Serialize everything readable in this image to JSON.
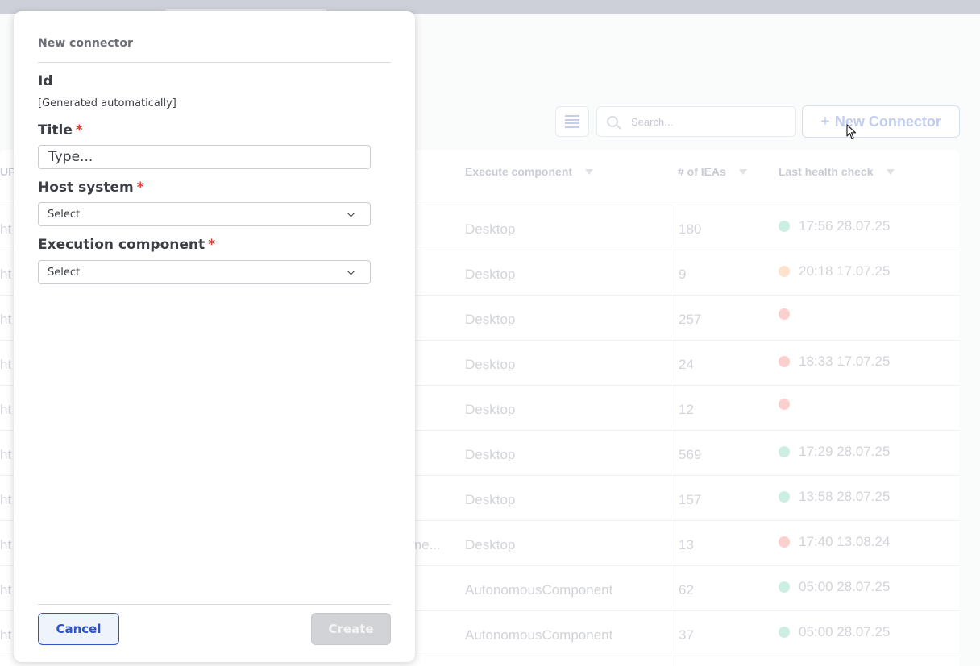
{
  "background": {
    "search_placeholder": "Search...",
    "new_connector_button": "+ New Connector",
    "plus": "+",
    "new_connector_label": "New Connector",
    "columns": {
      "ur_partial": "UF",
      "execute_component": "Execute component",
      "num_ieas": "# of IEAs",
      "last_health_check": "Last health check"
    },
    "rows": [
      {
        "c0": "ht",
        "mid": "",
        "component": "Desktop",
        "ieas": "180",
        "status": "green",
        "time": "17:56 28.07.25"
      },
      {
        "c0": "ht",
        "mid": "",
        "component": "Desktop",
        "ieas": "9",
        "status": "orange",
        "time": "20:18 17.07.25"
      },
      {
        "c0": "ht",
        "mid": "",
        "component": "Desktop",
        "ieas": "257",
        "status": "red",
        "time": ""
      },
      {
        "c0": "ht",
        "mid": "",
        "component": "Desktop",
        "ieas": "24",
        "status": "red",
        "time": "18:33 17.07.25"
      },
      {
        "c0": "ht",
        "mid": "",
        "component": "Desktop",
        "ieas": "12",
        "status": "red",
        "time": ""
      },
      {
        "c0": "ht",
        "mid": "",
        "component": "Desktop",
        "ieas": "569",
        "status": "green",
        "time": "17:29 28.07.25"
      },
      {
        "c0": "ht",
        "mid": "",
        "component": "Desktop",
        "ieas": "157",
        "status": "green",
        "time": "13:58 28.07.25"
      },
      {
        "c0": "ht",
        "mid": "me...",
        "component": "Desktop",
        "ieas": "13",
        "status": "red",
        "time": "17:40 13.08.24"
      },
      {
        "c0": "ht",
        "mid": "",
        "component": "AutonomousComponent",
        "ieas": "62",
        "status": "green",
        "time": "05:00 28.07.25"
      },
      {
        "c0": "ht",
        "mid": "",
        "component": "AutonomousComponent",
        "ieas": "37",
        "status": "green",
        "time": "05:00 28.07.25"
      }
    ],
    "status_colors": {
      "green": "#cdeee3",
      "orange": "#fde3cc",
      "red": "#fbcfcd"
    }
  },
  "modal": {
    "title": "New connector",
    "id_label": "Id",
    "id_value": "[Generated automatically]",
    "title_label": "Title",
    "title_placeholder": "Type...",
    "host_label": "Host system",
    "host_select": "Select",
    "exec_label": "Execution component",
    "exec_select": "Select",
    "required_mark": "*",
    "cancel_label": "Cancel",
    "create_label": "Create"
  },
  "colors": {
    "accent": "#2f53c7",
    "required": "#e53935",
    "disabled_button": "#d2d3d6"
  }
}
